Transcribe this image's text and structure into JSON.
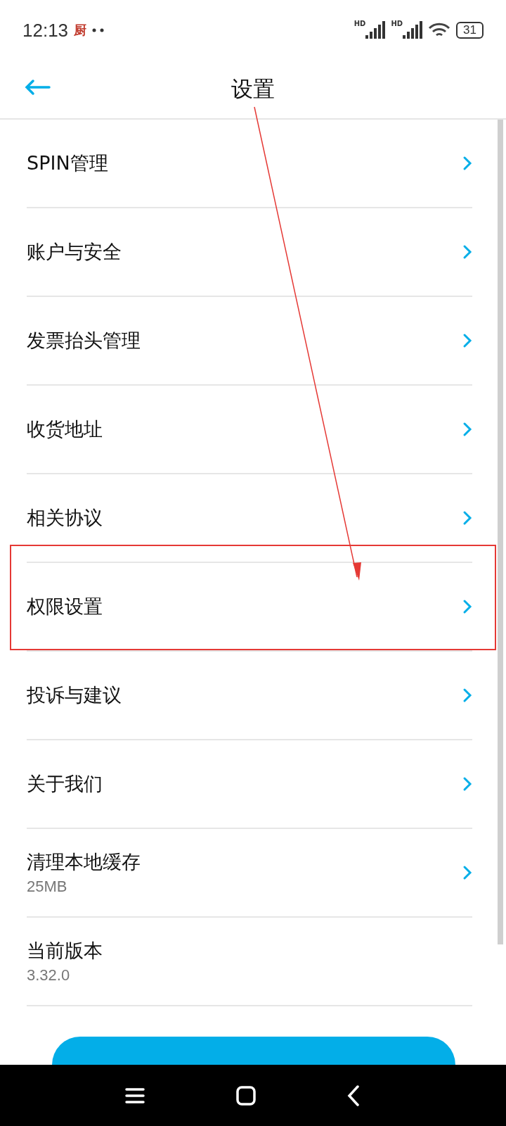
{
  "status_bar": {
    "time": "12:13",
    "app_glyph": "厨",
    "battery": "31",
    "signal_labels": [
      "HD",
      "HD"
    ]
  },
  "header": {
    "title": "设置"
  },
  "items": [
    {
      "label": "SPIN管理",
      "chevron": true,
      "highlighted": false
    },
    {
      "label": "账户与安全",
      "chevron": true,
      "highlighted": false
    },
    {
      "label": "发票抬头管理",
      "chevron": true,
      "highlighted": false
    },
    {
      "label": "收货地址",
      "chevron": true,
      "highlighted": false
    },
    {
      "label": "相关协议",
      "chevron": true,
      "highlighted": false
    },
    {
      "label": "权限设置",
      "chevron": true,
      "highlighted": true
    },
    {
      "label": "投诉与建议",
      "chevron": true,
      "highlighted": false
    },
    {
      "label": "关于我们",
      "chevron": true,
      "highlighted": false
    },
    {
      "label": "清理本地缓存",
      "sub": "25MB",
      "chevron": true,
      "highlighted": false
    },
    {
      "label": "当前版本",
      "sub": "3.32.0",
      "chevron": false,
      "highlighted": false
    }
  ],
  "annotation_arrow": true
}
